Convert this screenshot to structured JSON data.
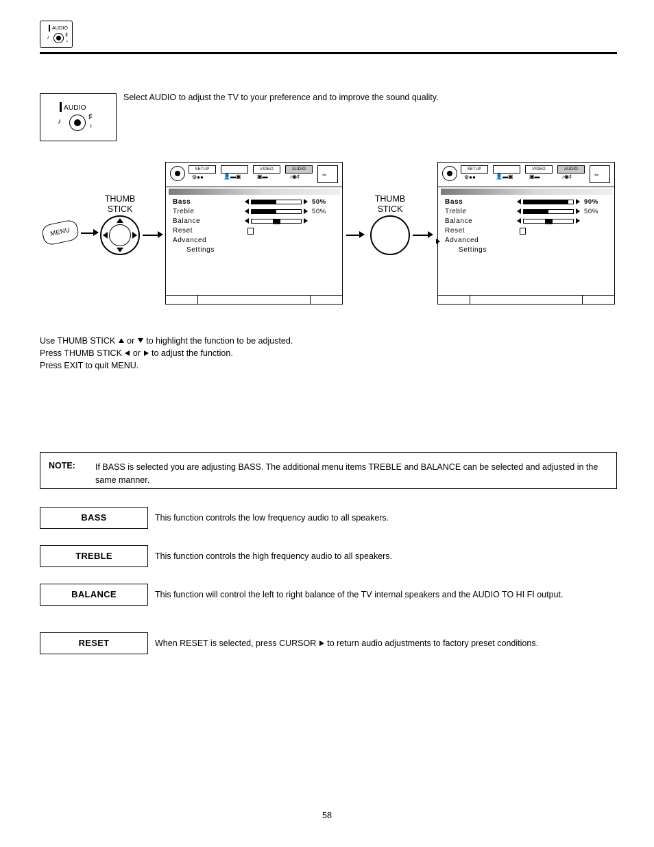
{
  "header": {
    "badge_label": "AUDIO"
  },
  "intro": {
    "text": "Select AUDIO to adjust the TV to your preference and to improve the sound quality."
  },
  "osd": {
    "tabs": [
      {
        "label": "SETUP",
        "active": false
      },
      {
        "label": "",
        "active": false
      },
      {
        "label": "VIDEO",
        "active": false
      },
      {
        "label": "AUDIO",
        "active": true
      },
      {
        "label": "",
        "active": false
      }
    ],
    "menu_items": [
      "Bass",
      "Treble",
      "Balance",
      "Reset",
      "Advanced",
      "Settings"
    ],
    "screen_left": {
      "bass_value": "50%",
      "treble_value": "50%",
      "bass_fill_pct": 50,
      "treble_fill_pct": 50,
      "balance_pos_pct": 50
    },
    "screen_right": {
      "bass_value": "90%",
      "treble_value": "50%",
      "bass_fill_pct": 90,
      "treble_fill_pct": 50,
      "balance_pos_pct": 50
    }
  },
  "controls": {
    "menu_button_label": "MENU",
    "thumb_stick_line1": "THUMB",
    "thumb_stick_line2": "STICK"
  },
  "instructions": {
    "line1_a": "Use THUMB STICK",
    "line1_b": "or",
    "line1_c": "to highlight the function to be adjusted.",
    "line2_a": "Press THUMB STICK",
    "line2_b": "or",
    "line2_c": "to adjust the function.",
    "line3": "Press EXIT to quit MENU."
  },
  "note": {
    "label": "NOTE:",
    "text": "If BASS is selected you are adjusting BASS.  The additional menu items TREBLE and BALANCE can be selected and adjusted in the same manner."
  },
  "functions": [
    {
      "name": "BASS",
      "description": "This function controls the low frequency audio to all speakers."
    },
    {
      "name": "TREBLE",
      "description": "This function controls the high frequency audio to all speakers."
    },
    {
      "name": "BALANCE",
      "description": "This function will control the left to right balance of the TV internal speakers and the AUDIO TO HI FI output."
    },
    {
      "name": "RESET",
      "description_a": "When RESET is selected, press CURSOR",
      "description_b": "to return audio adjustments to factory preset conditions."
    }
  ],
  "page_number": "58"
}
